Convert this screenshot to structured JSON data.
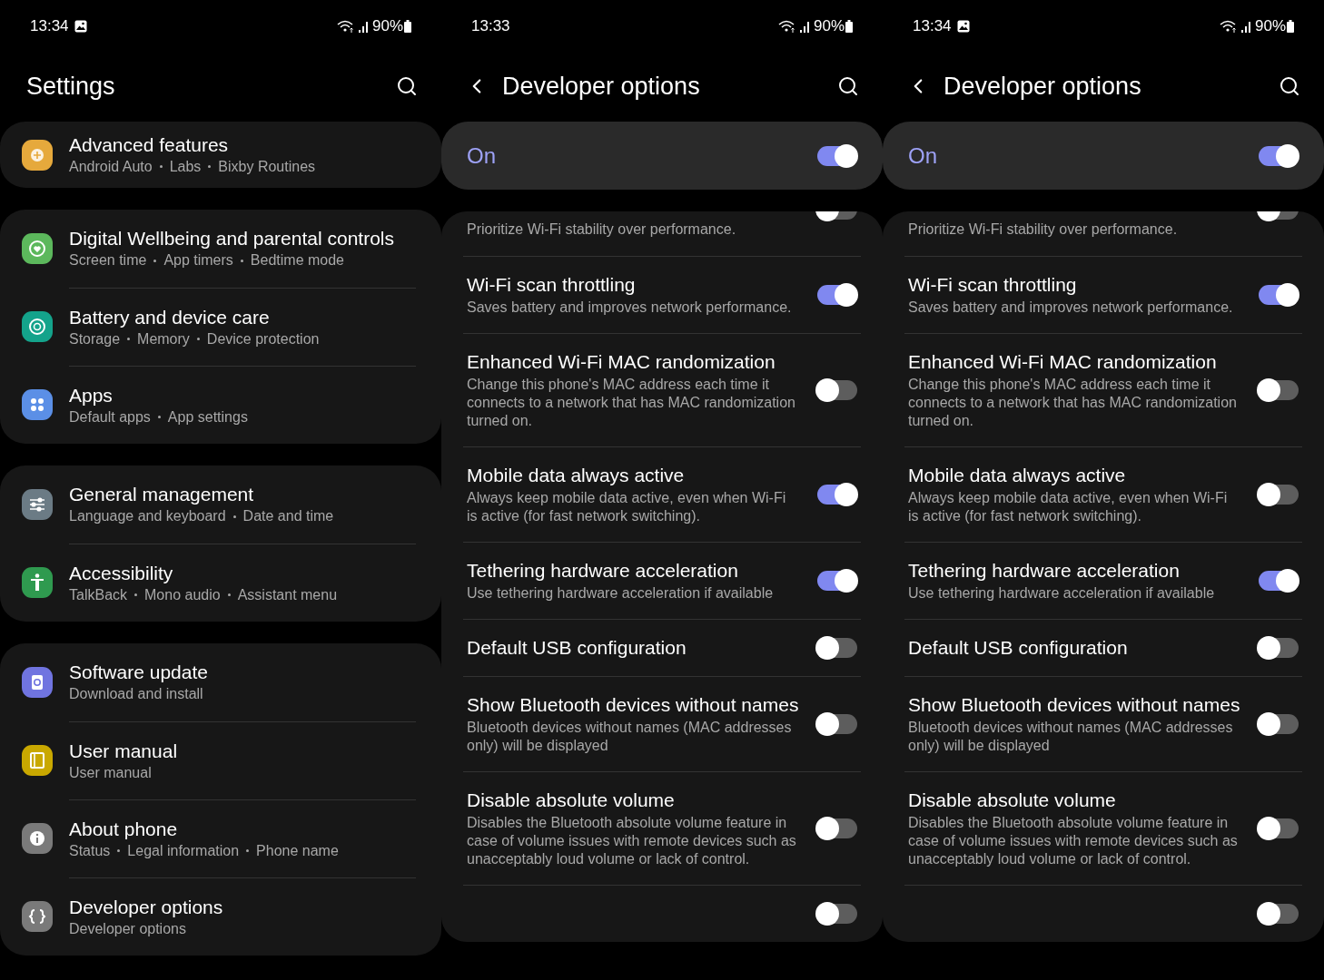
{
  "screens": [
    {
      "kind": "settings",
      "status_bar": {
        "time": "13:34",
        "battery": "90%"
      },
      "title": "Settings",
      "groups": [
        {
          "items": [
            {
              "title": "Advanced features",
              "subtitle": [
                "Android Auto",
                "Labs",
                "Bixby Routines"
              ],
              "color": "#e6a93c"
            }
          ]
        },
        {
          "items": [
            {
              "title": "Digital Wellbeing and parental controls",
              "subtitle": [
                "Screen time",
                "App timers",
                "Bedtime mode"
              ],
              "color": "#5cb85c"
            },
            {
              "title": "Battery and device care",
              "subtitle": [
                "Storage",
                "Memory",
                "Device protection"
              ],
              "color": "#14a38b"
            },
            {
              "title": "Apps",
              "subtitle": [
                "Default apps",
                "App settings"
              ],
              "color": "#5b8fe6"
            }
          ]
        },
        {
          "items": [
            {
              "title": "General management",
              "subtitle": [
                "Language and keyboard",
                "Date and time"
              ],
              "color": "#6b7b85"
            },
            {
              "title": "Accessibility",
              "subtitle": [
                "TalkBack",
                "Mono audio",
                "Assistant menu"
              ],
              "color": "#2f9a4f"
            }
          ]
        },
        {
          "items": [
            {
              "title": "Software update",
              "subtitle": [
                "Download and install"
              ],
              "color": "#7074e0"
            },
            {
              "title": "User manual",
              "subtitle": [
                "User manual"
              ],
              "color": "#c9a800"
            },
            {
              "title": "About phone",
              "subtitle": [
                "Status",
                "Legal information",
                "Phone name"
              ],
              "color": "#7a7a7a"
            },
            {
              "title": "Developer options",
              "subtitle": [
                "Developer options"
              ],
              "color": "#7a7a7a"
            }
          ]
        }
      ]
    },
    {
      "kind": "developer",
      "status_bar": {
        "time": "13:33",
        "battery": "90%"
      },
      "title": "Developer options",
      "master": {
        "label": "On",
        "on": true
      },
      "items": [
        {
          "description": "Prioritize Wi-Fi stability over performance.",
          "on": false
        },
        {
          "title": "Wi-Fi scan throttling",
          "description": "Saves battery and improves network performance.",
          "on": true
        },
        {
          "title": "Enhanced Wi-Fi MAC randomization",
          "description": "Change this phone's MAC address each time it connects to a network that has MAC randomization turned on.",
          "on": false
        },
        {
          "title": "Mobile data always active",
          "description": "Always keep mobile data active, even when Wi-Fi is active (for fast network switching).",
          "on": true
        },
        {
          "title": "Tethering hardware acceleration",
          "description": "Use tethering hardware acceleration if available",
          "on": true
        },
        {
          "title": "Default USB configuration",
          "on": false
        },
        {
          "title": "Show Bluetooth devices without names",
          "description": "Bluetooth devices without names (MAC addresses only) will be displayed",
          "on": false
        },
        {
          "title": "Disable absolute volume",
          "description": "Disables the Bluetooth absolute volume feature in case of volume issues with remote devices such as unacceptably loud volume or lack of control.",
          "on": false
        },
        {
          "on": false
        }
      ]
    },
    {
      "kind": "developer",
      "status_bar": {
        "time": "13:34",
        "battery": "90%"
      },
      "title": "Developer options",
      "master": {
        "label": "On",
        "on": true
      },
      "items": [
        {
          "description": "Prioritize Wi-Fi stability over performance.",
          "on": false
        },
        {
          "title": "Wi-Fi scan throttling",
          "description": "Saves battery and improves network performance.",
          "on": true
        },
        {
          "title": "Enhanced Wi-Fi MAC randomization",
          "description": "Change this phone's MAC address each time it connects to a network that has MAC randomization turned on.",
          "on": false
        },
        {
          "title": "Mobile data always active",
          "description": "Always keep mobile data active, even when Wi-Fi is active (for fast network switching).",
          "on": false
        },
        {
          "title": "Tethering hardware acceleration",
          "description": "Use tethering hardware acceleration if available",
          "on": true
        },
        {
          "title": "Default USB configuration",
          "on": false
        },
        {
          "title": "Show Bluetooth devices without names",
          "description": "Bluetooth devices without names (MAC addresses only) will be displayed",
          "on": false
        },
        {
          "title": "Disable absolute volume",
          "description": "Disables the Bluetooth absolute volume feature in case of volume issues with remote devices such as unacceptably loud volume or lack of control.",
          "on": false
        },
        {
          "on": false
        }
      ]
    }
  ]
}
